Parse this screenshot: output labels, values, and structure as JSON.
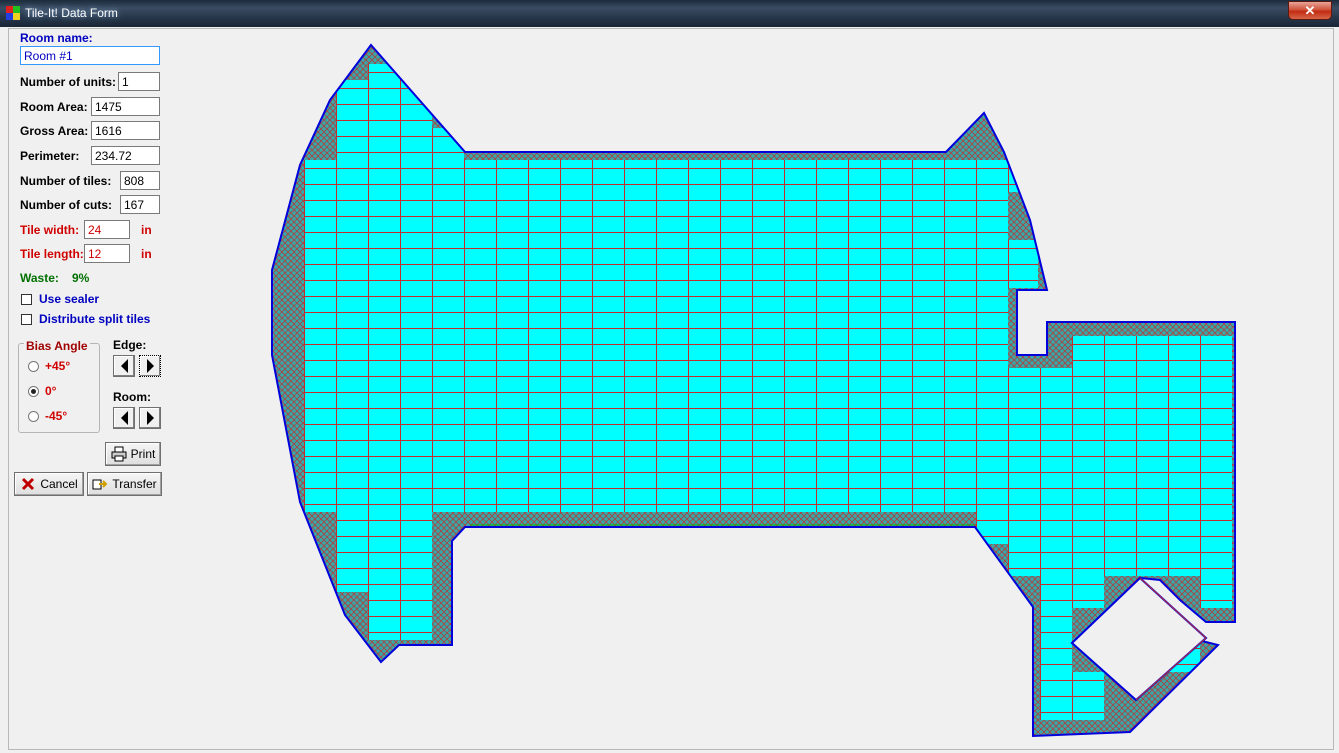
{
  "window": {
    "title": "Tile-It! Data Form",
    "close_glyph": "✕"
  },
  "form": {
    "room_name_label": "Room name:",
    "room_name_value": "Room #1",
    "units_label": "Number of units:",
    "units_value": "1",
    "room_area_label": "Room Area:",
    "room_area_value": "1475",
    "gross_area_label": "Gross Area:",
    "gross_area_value": "1616",
    "perimeter_label": "Perimeter:",
    "perimeter_value": "234.72",
    "tiles_label": "Number of tiles:",
    "tiles_value": "808",
    "cuts_label": "Number of cuts:",
    "cuts_value": "167",
    "tile_width_label": "Tile width:",
    "tile_width_value": "24",
    "tile_width_unit": "in",
    "tile_length_label": "Tile length:",
    "tile_length_value": "12",
    "tile_length_unit": "in",
    "waste_label": "Waste:",
    "waste_value": "9%",
    "use_sealer_label": "Use sealer",
    "use_sealer_checked": false,
    "distribute_label": "Distribute split tiles",
    "distribute_checked": false
  },
  "bias_angle": {
    "title": "Bias Angle",
    "options": [
      "+45°",
      "0°",
      "-45°"
    ],
    "selected": "0°"
  },
  "edge_label": "Edge:",
  "room_label": "Room:",
  "buttons": {
    "print": "Print",
    "cancel": "Cancel",
    "transfer": "Transfer"
  },
  "colors": {
    "tile_fill": "#00ffff",
    "grout": "#c03030",
    "outline": "#0000dd",
    "cut_tile": "#3aa6a6",
    "label_blue": "#0000c0",
    "label_red": "#d00000",
    "label_green": "#007000"
  }
}
